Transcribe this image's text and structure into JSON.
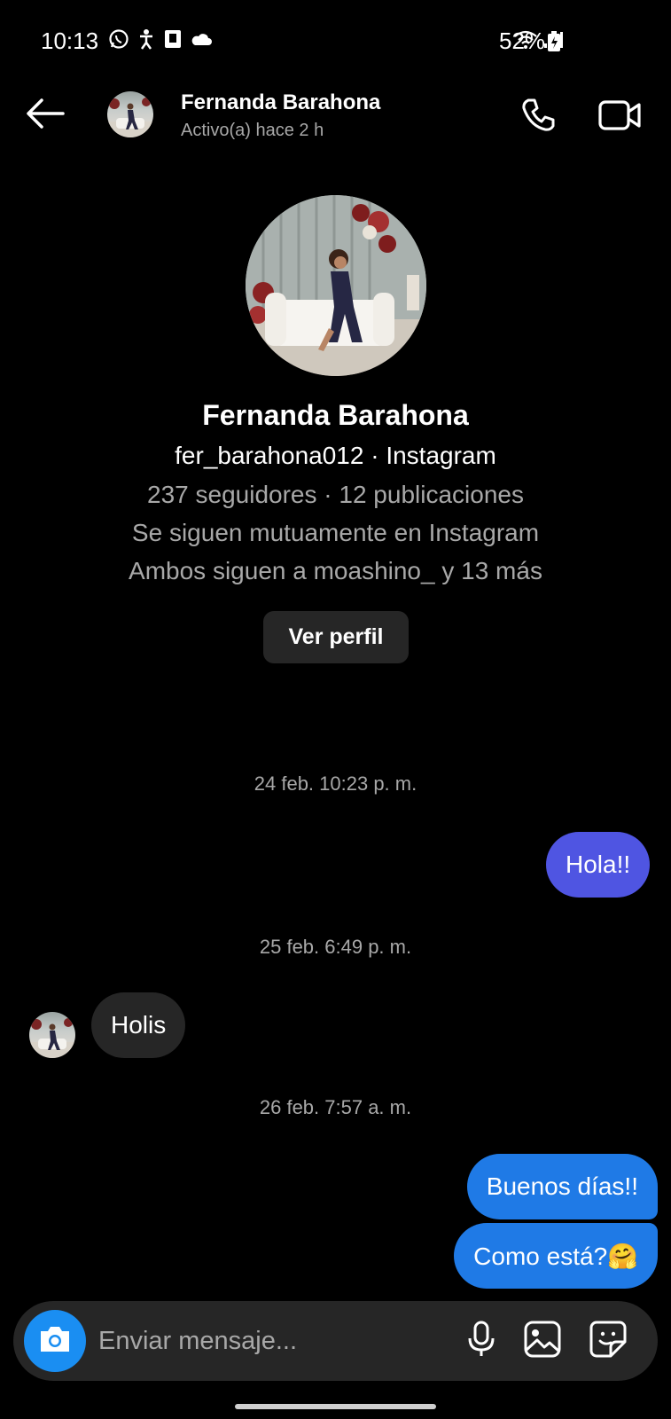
{
  "status_bar": {
    "time": "10:13",
    "battery": "52%"
  },
  "header": {
    "name": "Fernanda Barahona",
    "status": "Activo(a) hace 2 h"
  },
  "profile": {
    "name": "Fernanda Barahona",
    "username_line": "fer_barahona012 · Instagram",
    "stats": "237 seguidores · 12 publicaciones",
    "mutual": "Se siguen mutuamente en Instagram",
    "common": "Ambos siguen a moashino_ y 13 más",
    "view_profile_label": "Ver perfil"
  },
  "messages": {
    "ts1": "24 feb. 10:23 p. m.",
    "msg1": "Hola!!",
    "ts2": "25 feb. 6:49 p. m.",
    "msg2": "Holis",
    "ts3": "26 feb. 7:57 a. m.",
    "msg3": "Buenos días!!",
    "msg4": "Como está?🤗"
  },
  "composer": {
    "placeholder": "Enviar mensaje..."
  },
  "colors": {
    "bubble_purple": "#4f55e2",
    "bubble_blue": "#1f7ae6",
    "bubble_incoming": "#262626",
    "camera_button": "#1a8ef2"
  },
  "icons": [
    "whatsapp-icon",
    "accessibility-icon",
    "sim-icon",
    "cloud-icon",
    "wifi-icon",
    "signal-icon",
    "battery-icon",
    "back-arrow-icon",
    "phone-icon",
    "video-camera-icon",
    "camera-icon",
    "microphone-icon",
    "gallery-icon",
    "sticker-icon"
  ]
}
